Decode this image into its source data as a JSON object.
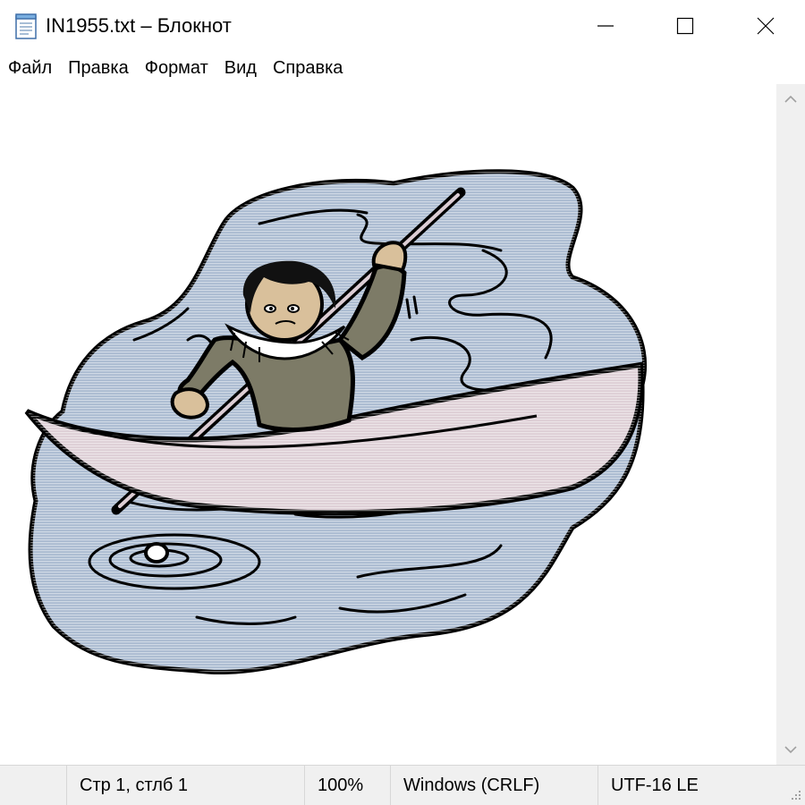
{
  "window": {
    "title": "IN1955.txt – Блокнот",
    "icon": "notepad-icon"
  },
  "menu": {
    "items": [
      "Файл",
      "Правка",
      "Формат",
      "Вид",
      "Справка"
    ]
  },
  "statusbar": {
    "position": "Стр 1, стлб 1",
    "zoom": "100%",
    "line_ending": "Windows (CRLF)",
    "encoding": "UTF-16 LE"
  },
  "colors": {
    "water": "#a8b9cf",
    "kayak": "#dccdd4",
    "parka": "#7d7b67",
    "skin": "#d9c09b",
    "hair": "#111111",
    "chrome": "#f0f0f0"
  }
}
